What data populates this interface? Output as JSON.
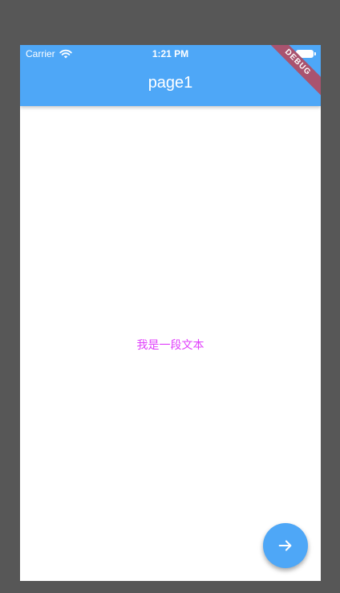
{
  "status_bar": {
    "carrier": "Carrier",
    "time": "1:21 PM"
  },
  "app_bar": {
    "title": "page1",
    "color": "#4ea7f7"
  },
  "debug_banner": {
    "label": "DEBUG"
  },
  "body": {
    "text": "我是一段文本",
    "text_color": "#e040fb"
  },
  "fab": {
    "icon": "arrow-forward-icon"
  }
}
